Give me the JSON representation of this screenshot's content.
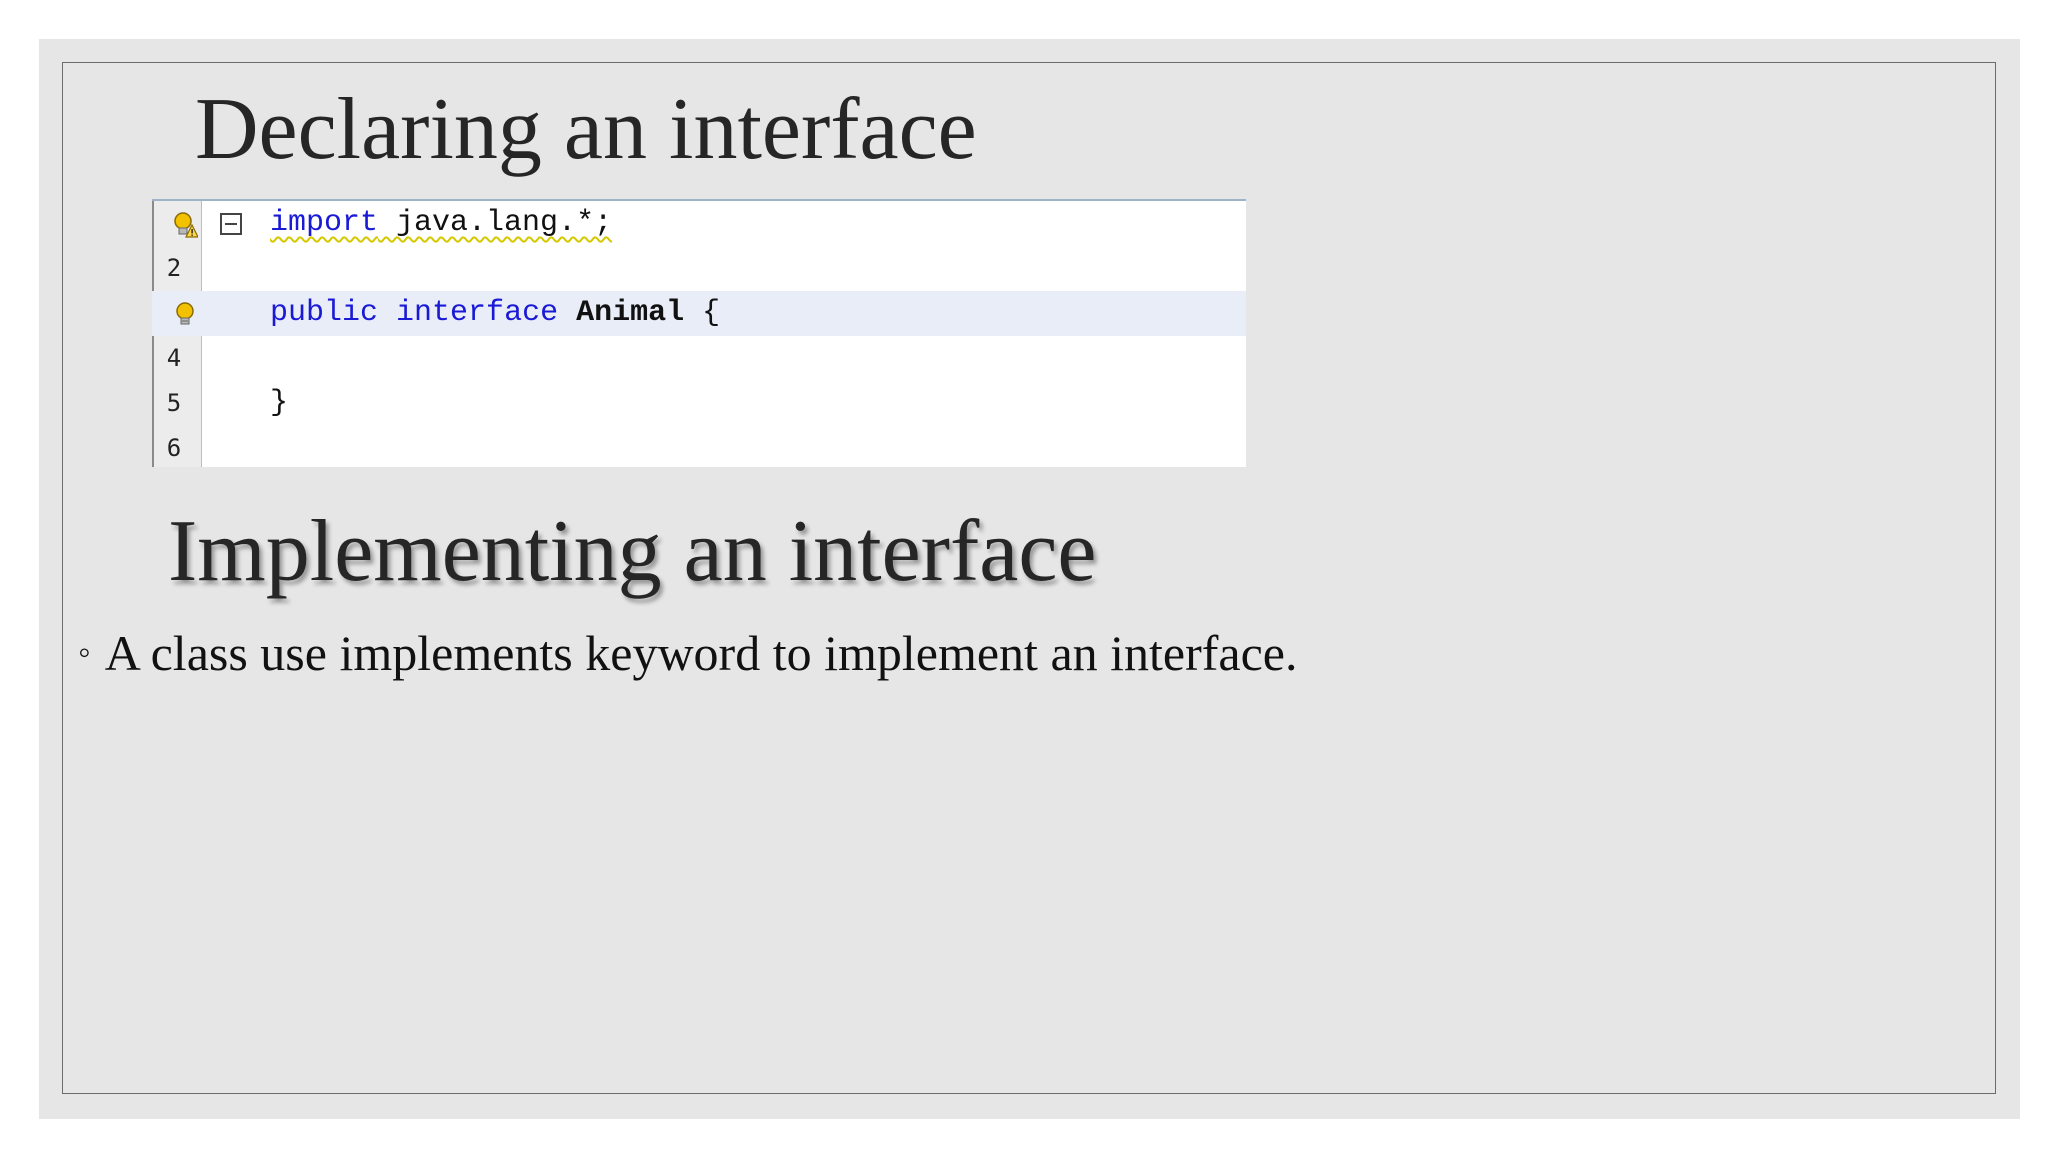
{
  "slide": {
    "heading_1": "Declaring an interface",
    "heading_2": "Implementing an interface",
    "bullet_mark": "◦",
    "bullet_text": "A class use implements keyword to implement an interface."
  },
  "code_editor": {
    "lines": [
      {
        "number": "1",
        "gutter_icon": "warning-lightbulb-icon",
        "foldable": true,
        "tokens": {
          "keyword": "import",
          "rest": " java.lang.*;"
        }
      },
      {
        "number": "2",
        "gutter_icon": "",
        "foldable": false,
        "tokens": {}
      },
      {
        "number": "3",
        "gutter_icon": "lightbulb-icon",
        "foldable": false,
        "highlighted": true,
        "tokens": {
          "kw1": "public",
          "kw2": "interface",
          "name": "Animal",
          "brace": "{"
        }
      },
      {
        "number": "4",
        "gutter_icon": "",
        "foldable": false,
        "tokens": {}
      },
      {
        "number": "5",
        "gutter_icon": "",
        "foldable": false,
        "tokens": {
          "brace": "}"
        }
      },
      {
        "number": "6",
        "gutter_icon": "",
        "foldable": false,
        "tokens": {}
      }
    ],
    "colors": {
      "keyword": "#1a1ad6",
      "line_highlight": "#e8edf7",
      "warning_underline": "#d6c800",
      "bulb": "#e8b400"
    }
  }
}
